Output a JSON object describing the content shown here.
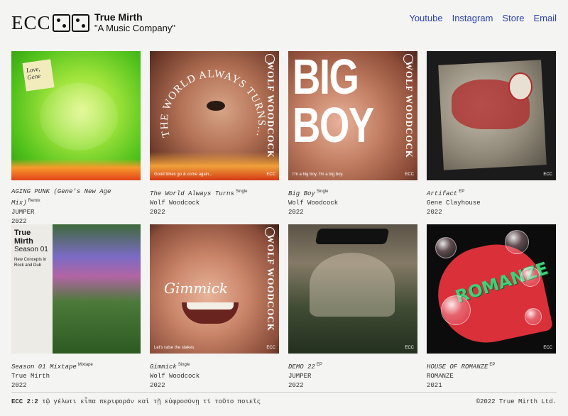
{
  "header": {
    "logo_text": "ECC",
    "brand_name": "True Mirth",
    "brand_tagline": "\"A Music Company\"",
    "nav": [
      "Youtube",
      "Instagram",
      "Store",
      "Email"
    ]
  },
  "releases": [
    {
      "title": "AGING PUNK (Gene's New Age Mix)",
      "type": "Remix",
      "artist": "JUMPER",
      "year": "2022",
      "cover_note": "Love, Gene"
    },
    {
      "title": "The World Always Turns",
      "type": "Single",
      "artist": "Wolf Woodcock",
      "year": "2022",
      "cover_text": "THE WORLD ALWAYS TURNS...",
      "cover_side": "WOLF WOODCOCK",
      "cover_tagline": "Good times go & come again...",
      "cover_badge": "ECC"
    },
    {
      "title": "Big Boy",
      "type": "Single",
      "artist": "Wolf Woodcock",
      "year": "2022",
      "cover_text_1": "BIG",
      "cover_text_2": "BOY",
      "cover_side": "WOLF WOODCOCK",
      "cover_tagline": "I'm a big boy, I'm a big boy.",
      "cover_badge": "ECC"
    },
    {
      "title": "Artifact",
      "type": "EP",
      "artist": "Gene Clayhouse",
      "year": "2022",
      "cover_badge": "ECC"
    },
    {
      "title": "Season 01 Mixtape",
      "type": "Mixtape",
      "artist": "True Mirth",
      "year": "2022",
      "cover_t1": "True Mirth",
      "cover_t2": "Season 01",
      "cover_t3": "New Concepts in Rock and Dub"
    },
    {
      "title": "Gimmick",
      "type": "Single",
      "artist": "Wolf Woodcock",
      "year": "2022",
      "cover_script": "Gimmick",
      "cover_side": "WOLF WOODCOCK",
      "cover_tagline": "Let's raise the stakes.",
      "cover_badge": "ECC"
    },
    {
      "title": "DEMO 22",
      "type": "EP",
      "artist": "JUMPER",
      "year": "2022",
      "cover_badge": "ECC"
    },
    {
      "title": "HOUSE OF ROMANZE",
      "type": "EP",
      "artist": "ROMANZE",
      "year": "2021",
      "cover_word": "ROMANZE",
      "cover_badge": "ECC"
    }
  ],
  "footer": {
    "left_bold": "ECC 2:2",
    "left_text": "τῷ γέλωτι εἶπα περιφοράν καὶ τῇ εὐφροσύνῃ τί τοῦτο ποιεῖς",
    "right_text": "©2022 True Mirth Ltd."
  }
}
